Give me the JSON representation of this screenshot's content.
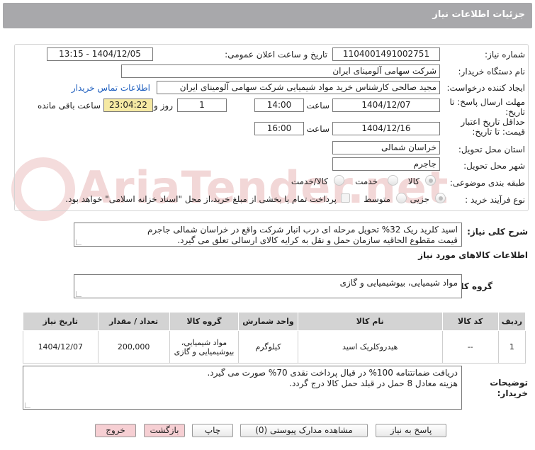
{
  "header": {
    "title": "جزئیات اطلاعات نیاز"
  },
  "watermark": "AriaTender.net",
  "need_number": {
    "label": "شماره نیاز:",
    "value": "1104001491002751"
  },
  "announce": {
    "label": "تاریخ و ساعت اعلان عمومی:",
    "value": "1404/12/05 - 13:15"
  },
  "buyer_org": {
    "label": "نام دستگاه خریدار:",
    "value": "شرکت سهامی آلومینای ایران"
  },
  "requester": {
    "label": "ایجاد کننده درخواست:",
    "value": "مجید صالحی کارشناس خرید مواد شیمیایی شرکت سهامی آلومینای ایران",
    "contact_link": "اطلاعات تماس خریدار"
  },
  "deadline": {
    "label_line1": "مهلت ارسال پاسخ: تا",
    "label_line2": "تاریخ:",
    "date": "1404/12/07",
    "time_label": "ساعت",
    "time": "14:00",
    "days": "1",
    "days_label": "روز و",
    "remaining": "23:04:22",
    "remaining_label": "ساعت باقی مانده"
  },
  "validity": {
    "label_line1": "حداقل تاریخ اعتبار",
    "label_line2": "قیمت: تا تاریخ:",
    "date": "1404/12/16",
    "time_label": "ساعت",
    "time": "16:00"
  },
  "province": {
    "label": "استان محل تحویل:",
    "value": "خراسان شمالی"
  },
  "city": {
    "label": "شهر محل تحویل:",
    "value": "جاجرم"
  },
  "category": {
    "label": "طبقه بندی موضوعی:",
    "options": [
      "کالا",
      "خدمت",
      "کالا/خدمت"
    ],
    "selected": "کالا"
  },
  "purchase_type": {
    "label": "نوع فرآیند خرید :",
    "options": [
      "جزیی",
      "متوسط"
    ],
    "selected": "جزیی",
    "note": "پرداخت تمام یا بخشی از مبلغ خرید،از محل \"اسناد خزانه اسلامی\" خواهد بود."
  },
  "summary": {
    "label": "شرح کلی نیاز:",
    "line1": "اسید کلرید ریک 32% تحویل مرحله ای درب انبار شرکت واقع در خراسان شمالی جاجرم",
    "line2": "قیمت مقطوع الحاقیه سازمان حمل و نقل به کرایه کالای ارسالی تعلق می گیرد."
  },
  "goods_info_title": "اطلاعات کالاهای مورد نیاز",
  "goods_group": {
    "label": "گروه کالا:",
    "value": "مواد شیمیایی، بیوشیمیایی و  گازی"
  },
  "table": {
    "headers": [
      "ردیف",
      "کد کالا",
      "نام کالا",
      "واحد شمارش",
      "گروه کالا",
      "تعداد / مقدار",
      "تاریخ نیاز"
    ],
    "rows": [
      {
        "row": "1",
        "code": "--",
        "name": "هیدروکلریک اسید",
        "unit": "کیلوگرم",
        "group": "مواد شیمیایی، بیوشیمیایی و گازی",
        "qty": "200,000",
        "date": "1404/12/07"
      }
    ]
  },
  "buyer_notes": {
    "label_line1": "توضیحات",
    "label_line2": "خریدار:",
    "line1": "دریافت ضمانتنامه 100% در قبال پرداخت نقدی 70% صورت می گیرد.",
    "line2": "هزینه معادل 8 حمل در قبلد حمل کالا درج گردد."
  },
  "buttons": {
    "reply": "پاسخ به نیاز",
    "docs": "مشاهده مدارک پیوستی (0)",
    "print": "چاپ",
    "back": "بازگشت",
    "exit": "خروج"
  }
}
